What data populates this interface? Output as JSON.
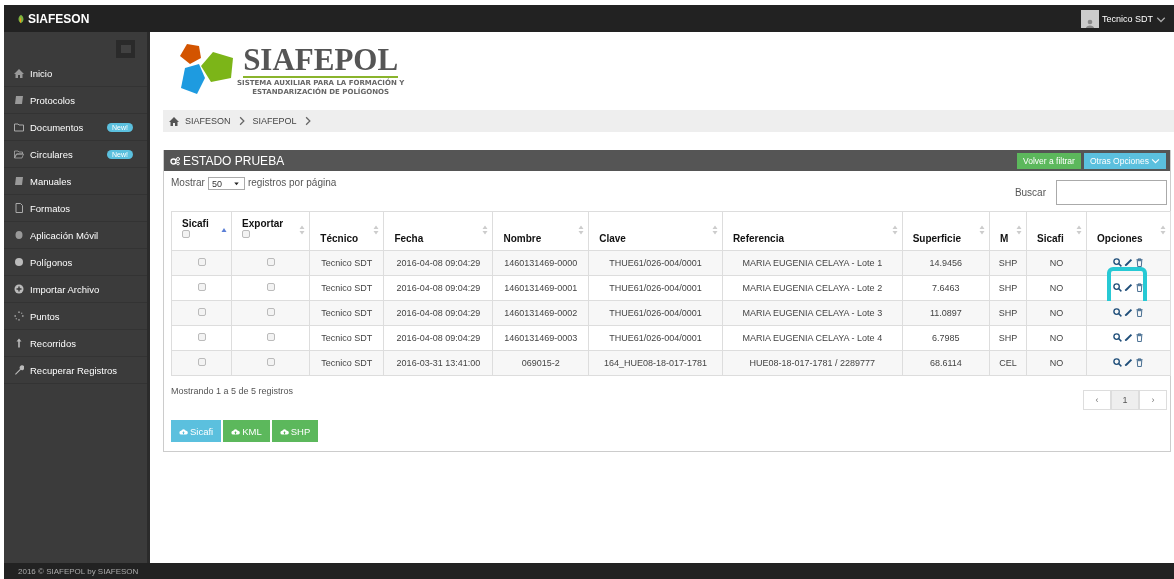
{
  "topbar": {
    "brand": "SIAFESON",
    "user": "Tecnico SDT"
  },
  "sidebar": {
    "items": [
      {
        "label": "Inicio"
      },
      {
        "label": "Protocolos"
      },
      {
        "label": "Documentos",
        "badge": "New!"
      },
      {
        "label": "Circulares",
        "badge": "New!"
      },
      {
        "label": "Manuales"
      },
      {
        "label": "Formatos"
      },
      {
        "label": "Aplicación Móvil"
      },
      {
        "label": "Polígonos"
      },
      {
        "label": "Importar Archivo"
      },
      {
        "label": "Puntos"
      },
      {
        "label": "Recorridos"
      },
      {
        "label": "Recuperar Registros"
      }
    ]
  },
  "logo": {
    "title": "SIAFEPOL",
    "subtitle": [
      "SISTEMA AUXILIAR PARA LA FORMACIÓN Y",
      "ESTANDARIZACIÓN DE POLÍGONOS"
    ]
  },
  "breadcrumb": [
    "SIAFESON",
    "SIAFEPOL"
  ],
  "panel": {
    "title": "ESTADO PRUEBA",
    "buttons": [
      {
        "label": "Volver a filtrar",
        "color": "#5cb85c"
      },
      {
        "label": "Otras Opciones",
        "color": "#5bc0de"
      }
    ],
    "length": {
      "before": "Mostrar",
      "value": "50",
      "after": "registros por página"
    },
    "search": {
      "label": "Buscar"
    },
    "table": {
      "columns": [
        {
          "label": "Sicafi",
          "kind": "check",
          "checked": false,
          "sorted_ascending": true
        },
        {
          "label": "Exportar",
          "kind": "check",
          "checked": false,
          "sorted_ascending": false
        },
        {
          "label": "Técnico",
          "kind": "text",
          "sorted_ascending": false
        },
        {
          "label": "Fecha",
          "kind": "text",
          "sorted_ascending": false
        },
        {
          "label": "Nombre",
          "kind": "text",
          "sorted_ascending": false
        },
        {
          "label": "Clave",
          "kind": "text",
          "sorted_ascending": false
        },
        {
          "label": "Referencia",
          "kind": "text",
          "sorted_ascending": false
        },
        {
          "label": "Superficie",
          "kind": "text",
          "sorted_ascending": false
        },
        {
          "label": "M",
          "kind": "text",
          "sorted_ascending": false
        },
        {
          "label": "Sicafi",
          "kind": "text",
          "sorted_ascending": false
        },
        {
          "label": "Opciones",
          "kind": "text",
          "sorted_ascending": false
        }
      ],
      "rows": [
        {
          "cells": [
            {
              "kind": "checkbox",
              "checked": false
            },
            {
              "kind": "checkbox",
              "checked": false
            },
            "Tecnico SDT",
            "2016-04-08 09:04:29",
            "1460131469-0000",
            "THUE61/026-004/0001",
            "MARIA EUGENIA CELAYA - Lote 1",
            "14.9456",
            "SHP",
            "NO"
          ],
          "highlighted": false
        },
        {
          "cells": [
            {
              "kind": "checkbox",
              "checked": false
            },
            {
              "kind": "checkbox",
              "checked": false
            },
            "Tecnico SDT",
            "2016-04-08 09:04:29",
            "1460131469-0001",
            "THUE61/026-004/0001",
            "MARIA EUGENIA CELAYA - Lote 2",
            "7.6463",
            "SHP",
            "NO"
          ],
          "highlighted": true
        },
        {
          "cells": [
            {
              "kind": "checkbox",
              "checked": false
            },
            {
              "kind": "checkbox",
              "checked": false
            },
            "Tecnico SDT",
            "2016-04-08 09:04:29",
            "1460131469-0002",
            "THUE61/026-004/0001",
            "MARIA EUGENIA CELAYA - Lote 3",
            "11.0897",
            "SHP",
            "NO"
          ],
          "highlighted": false
        },
        {
          "cells": [
            {
              "kind": "checkbox",
              "checked": false
            },
            {
              "kind": "checkbox",
              "checked": false
            },
            "Tecnico SDT",
            "2016-04-08 09:04:29",
            "1460131469-0003",
            "THUE61/026-004/0001",
            "MARIA EUGENIA CELAYA - Lote 4",
            "6.7985",
            "SHP",
            "NO"
          ],
          "highlighted": false
        },
        {
          "cells": [
            {
              "kind": "checkbox",
              "checked": false
            },
            {
              "kind": "checkbox",
              "checked": false
            },
            "Tecnico SDT",
            "2016-03-31 13:41:00",
            "069015-2",
            "164_HUE08-18-017-1781",
            "HUE08-18-017-1781 / 2289777",
            "68.6114",
            "CEL",
            "NO"
          ],
          "highlighted": false
        }
      ]
    },
    "info": "Mostrando 1 a 5 de 5 registros",
    "pagination": {
      "prev": "‹",
      "pages": [
        {
          "label": "1",
          "selected": true
        }
      ],
      "next": "›"
    },
    "export_buttons": [
      {
        "label": "Sicafi",
        "color": "#5bc0de"
      },
      {
        "label": "KML",
        "color": "#5cb85c"
      },
      {
        "label": "SHP",
        "color": "#5cb85c"
      }
    ]
  },
  "footer": "2016 © SIAFEPOL by SIAFESON"
}
